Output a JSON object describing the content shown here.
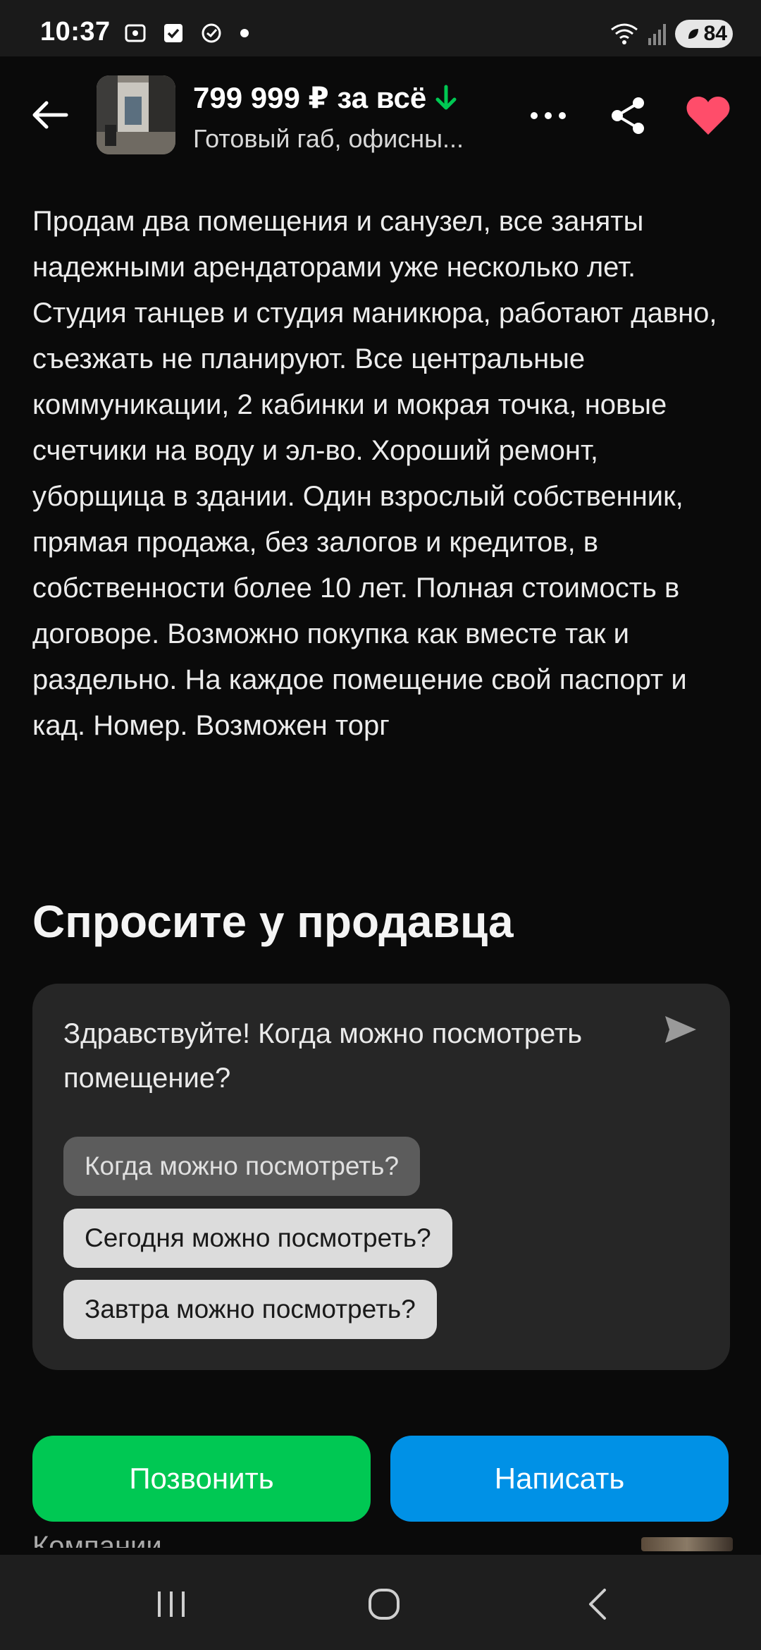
{
  "status_bar": {
    "time": "10:37",
    "icons": [
      "screenshot-icon",
      "checkbox-icon",
      "sync-check-icon",
      "notification-dot"
    ],
    "battery_level": "84",
    "wifi": "wifi-icon",
    "signal": "signal-icon"
  },
  "header": {
    "price": "799 999 ₽ за всё",
    "price_trend_icon": "arrow-down-icon",
    "subtitle": "Готовый габ, офисны...",
    "back_icon": "arrow-left-icon",
    "more_icon": "more-dots-icon",
    "share_icon": "share-icon",
    "favorite_icon": "heart-icon",
    "favorite_color": "#ff4d6a"
  },
  "description": "Продам два помещения и санузел, все заняты надежными арендаторами уже несколько лет. Студия танцев и студия маникюра, работают давно, съезжать не планируют. Все центральные коммуникации, 2 кабинки и мокрая точка, новые счетчики на воду и эл-во. Хороший ремонт, уборщица в здании. Один взрослый собственник, прямая продажа, без залогов и кредитов, в собственности более 10 лет. Полная стоимость в договоре. Возможно покупка как вместе так и раздельно. На каждое помещение свой паспорт и кад. Номер. Возможен торг",
  "ask_seller": {
    "title": "Спросите у продавца",
    "message": "Здравствуйте! Когда можно посмотреть помещение?",
    "send_icon": "send-icon",
    "suggestions": [
      "Когда можно посмотреть?",
      "Сегодня можно посмотреть?",
      "Завтра можно посмотреть?"
    ]
  },
  "actions": {
    "call_label": "Позвонить",
    "write_label": "Написать",
    "call_color": "#00c853",
    "write_color": "#0091e6"
  },
  "peek_text": "Компании",
  "nav_bar": {
    "recents_icon": "recents-icon",
    "home_icon": "home-icon",
    "back_icon": "nav-back-icon"
  }
}
